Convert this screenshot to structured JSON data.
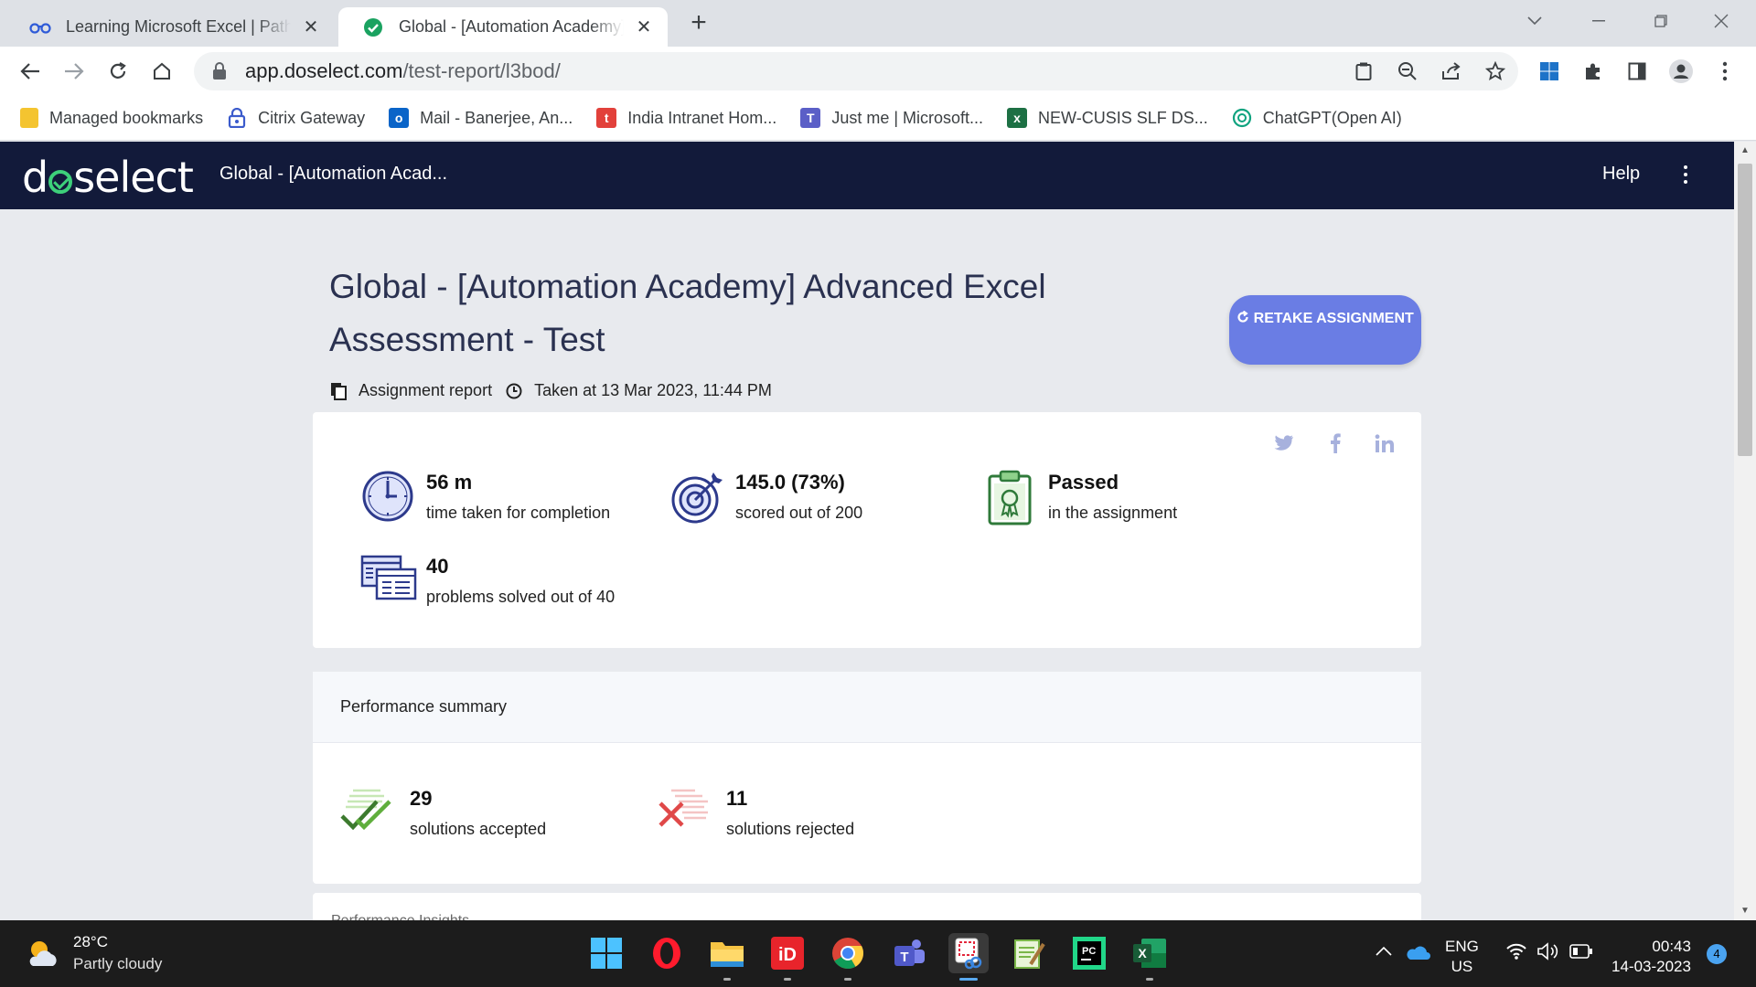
{
  "browser": {
    "tabs": [
      {
        "title": "Learning Microsoft Excel | Pathways",
        "icon": "pathways-icon",
        "active": false
      },
      {
        "title": "Global - [Automation Academy] Advanced",
        "icon": "check-circle-icon",
        "active": true
      }
    ],
    "new_tab": "+",
    "url_host": "app.doselect.com",
    "url_path": "/test-report/l3bod/",
    "bookmarks": [
      {
        "label": "Managed bookmarks",
        "icon": "folder-icon",
        "color": "#f4c430"
      },
      {
        "label": "Citrix Gateway",
        "icon": "lock-icon",
        "color": "#3b5bcc"
      },
      {
        "label": "Mail - Banerjee, An...",
        "icon": "outlook-icon",
        "color": "#0a64c8"
      },
      {
        "label": "India Intranet Hom...",
        "icon": "t-icon",
        "color": "#e2413b"
      },
      {
        "label": "Just me | Microsoft...",
        "icon": "teams-icon",
        "color": "#5b5fc7"
      },
      {
        "label": "NEW-CUSIS SLF DS...",
        "icon": "excel-icon",
        "color": "#1d7044"
      },
      {
        "label": "ChatGPT(Open AI)",
        "icon": "chatgpt-icon",
        "color": "#10a37f"
      }
    ]
  },
  "app": {
    "logo_pre": "d",
    "logo_post": "select",
    "title": "Global - [Automation Acad...",
    "help": "Help"
  },
  "report": {
    "heading": "Global - [Automation Academy] Advanced Excel Assessment - Test",
    "retake_label": "RETAKE ASSIGNMENT",
    "report_label": "Assignment report",
    "taken_at": "Taken at 13 Mar 2023, 11:44 PM",
    "stats": [
      {
        "value": "56 m",
        "label": "time taken for completion",
        "icon": "clock-icon"
      },
      {
        "value": "145.0 (73%)",
        "label": "scored out of 200",
        "icon": "target-icon"
      },
      {
        "value": "Passed",
        "label": "in the assignment",
        "icon": "certificate-icon"
      },
      {
        "value": "40",
        "label": "problems solved out of 40",
        "icon": "problems-icon"
      }
    ],
    "performance_title": "Performance summary",
    "accepted_count": "29",
    "accepted_label": "solutions accepted",
    "rejected_count": "11",
    "rejected_label": "solutions rejected",
    "insights_title": "Performance Insights"
  },
  "taskbar": {
    "temp": "28°C",
    "condition": "Partly cloudy",
    "lang_line1": "ENG",
    "lang_line2": "US",
    "time": "00:43",
    "date": "14-03-2023",
    "notifications": "4"
  },
  "colors": {
    "appbar": "#121a3a",
    "accent": "#6a7de4",
    "logo_green": "#3dd07a",
    "accept_green": "#5fae3c",
    "reject_red": "#e04848"
  }
}
